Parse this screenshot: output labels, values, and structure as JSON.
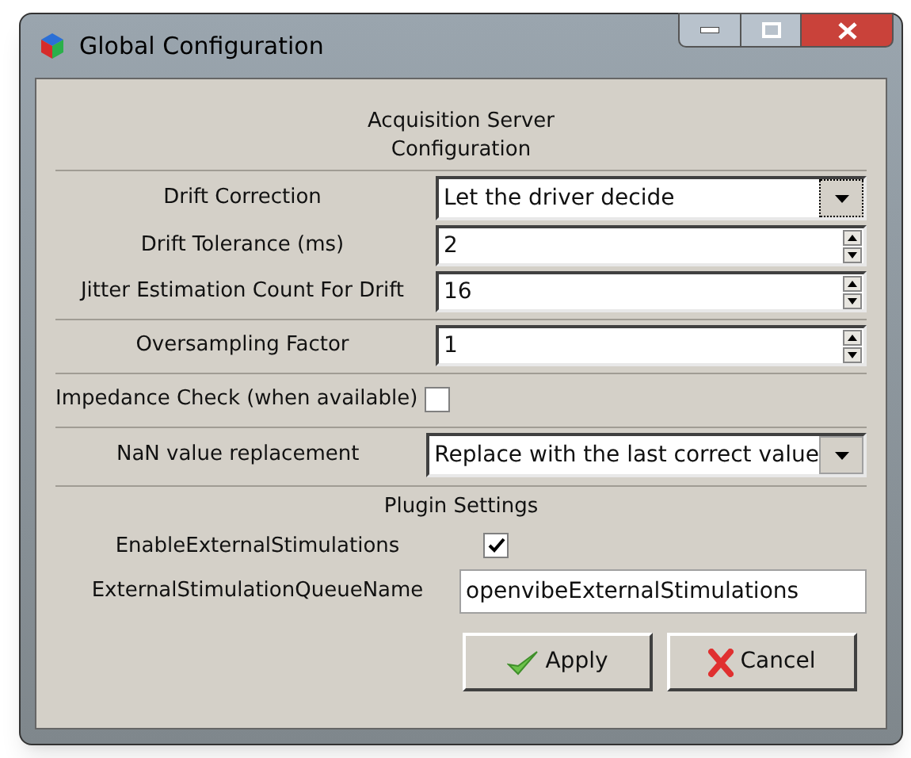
{
  "window": {
    "title": "Global Configuration"
  },
  "acquisition": {
    "title": "Acquisition Server\nConfiguration",
    "groups": [
      [
        {
          "kind": "combo",
          "label": "Drift Correction",
          "value": "Let the driver decide",
          "focused": true
        },
        {
          "kind": "spin",
          "label": "Drift Tolerance (ms)",
          "value": "2"
        },
        {
          "kind": "spin",
          "label": "Jitter Estimation Count For Drift",
          "value": "16"
        }
      ],
      [
        {
          "kind": "spin",
          "label": "Oversampling Factor",
          "value": "1"
        }
      ],
      [
        {
          "kind": "checkbox",
          "label": "Impedance Check (when available)",
          "checked": false
        }
      ],
      [
        {
          "kind": "combo",
          "label": "NaN value replacement",
          "value": "Replace with the last correct value",
          "focused": false
        }
      ]
    ]
  },
  "plugin": {
    "title": "Plugin Settings",
    "rows": [
      {
        "kind": "checkbox",
        "label": "EnableExternalStimulations",
        "checked": true
      },
      {
        "kind": "text",
        "label": "ExternalStimulationQueueName",
        "value": "openvibeExternalStimulations"
      }
    ]
  },
  "buttons": [
    {
      "kind": "apply",
      "label": "Apply"
    },
    {
      "kind": "cancel",
      "label": "Cancel"
    }
  ]
}
